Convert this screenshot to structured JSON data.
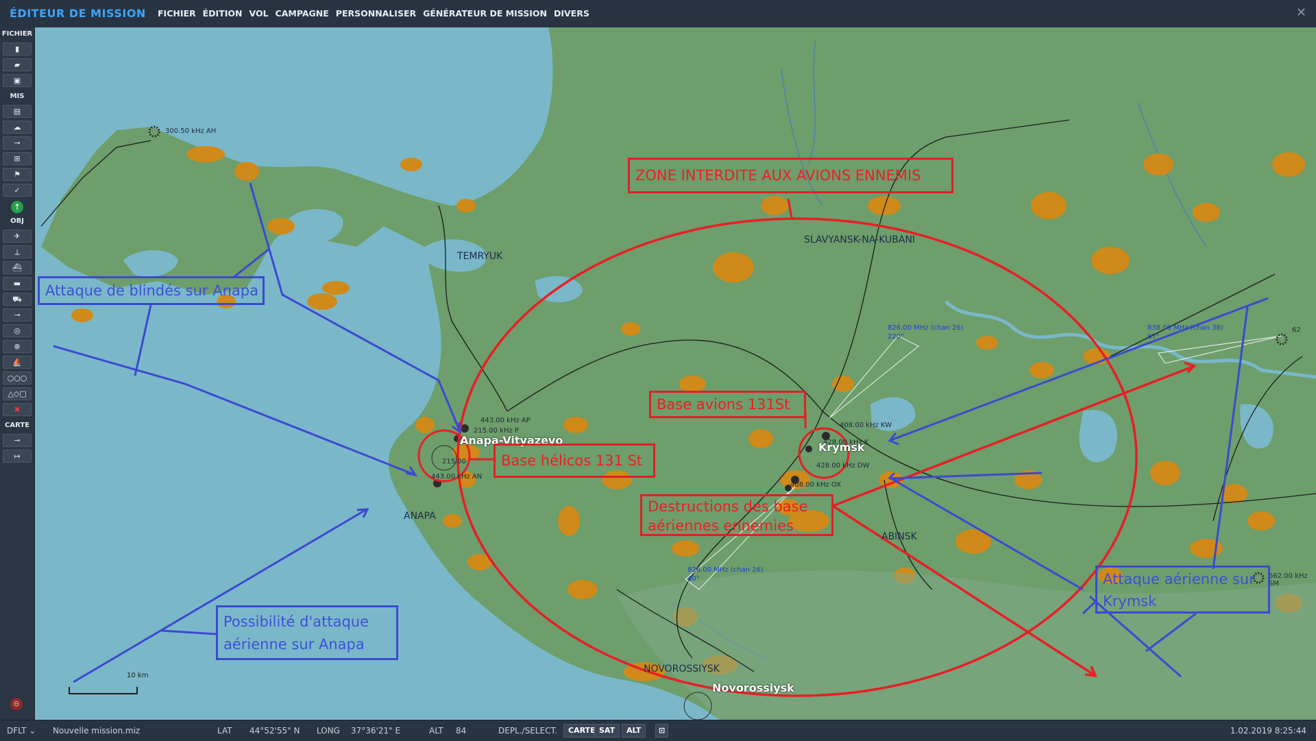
{
  "app": {
    "title": "ÉDITEUR DE MISSION",
    "close_icon": "close-icon"
  },
  "menu": [
    "FICHIER",
    "ÉDITION",
    "VOL",
    "CAMPAGNE",
    "PERSONNALISER",
    "GÉNÉRATEUR DE MISSION",
    "DIVERS"
  ],
  "toolbar": {
    "sections": {
      "file": "FICHIER",
      "mis": "MIS",
      "obj": "OBJ",
      "map": "CARTE"
    },
    "file_buttons": [
      "new-file-icon",
      "open-folder-icon",
      "save-icon"
    ],
    "mis_buttons": [
      "briefing-icon",
      "weather-icon",
      "route-icon",
      "trigger-zone-icon",
      "flag-icon",
      "check-icon"
    ],
    "obj_buttons": [
      "plane-icon",
      "helicopter-icon",
      "ship-icon",
      "vehicle-icon",
      "tank-icon",
      "airfield-icon",
      "target-icon",
      "static-icon",
      "boat-icon",
      "waypoint-chain-icon",
      "shapes-icon",
      "delete-icon"
    ],
    "map_buttons": [
      "map-key-icon",
      "ruler-icon"
    ]
  },
  "map_labels": {
    "temryuk": "TEMRYUK",
    "slavyansk": "SLAVYANSK-NA-KUBANI",
    "anapa_city": "ANAPA",
    "anapa_airfield": "Anapa-Vityazevo",
    "krymsk": "Krymsk",
    "abinsk": "ABINSK",
    "novorossiysk_region": "NOVOROSSIYSK",
    "novorossiysk_city": "Novorossiysk",
    "nav_anapa_ap": "443.00 kHz AP",
    "nav_anapa_freq_partial": "215.00 kHz P",
    "nav_anapa_215": "215.00",
    "nav_anapa_an": "443.00 kHz AN",
    "nav_ah": "300.50 kHz AH",
    "nav_kw": "408.00 kHz KW",
    "nav_krymsk_partial": "428.00 kHz K",
    "nav_dw": "428.00 kHz DW",
    "nav_ox": "408.00 kHz OX",
    "ils_krymsk_freq": "826.00 MHz (chan 26)",
    "ils_krymsk_hdg": "220°",
    "ils_south_freq": "826.00 MHz (chan 26)",
    "ils_south_hdg": "40°",
    "ils_east_freq": "838.00 MHz (chan 38)",
    "ils_east_hdg": "87°",
    "nav_east_partial": "62",
    "nav_sm": "662.00 kHz SM",
    "scale": "10 km"
  },
  "annotations": {
    "zone": "ZONE INTERDITE AUX AVIONS ENNEMIS",
    "attaque_blindes": "Attaque de blindés sur Anapa",
    "base_avions": "Base avions 131St",
    "base_helicos": "Base hélicos 131 St",
    "destructions_1": "Destructions des base",
    "destructions_2": "aériennes ennemies",
    "possibilite_1": "Possibilité d'attaque",
    "possibilite_2": "aérienne sur Anapa",
    "attaque_krymsk_1": "Attaque aérienne sur",
    "attaque_krymsk_2": "Krymsk"
  },
  "status": {
    "profile": "DFLT",
    "file": "Nouvelle mission.miz",
    "lat_label": "LAT",
    "lat": "44°52'55\" N",
    "long_label": "LONG",
    "long": "37°36'21\" E",
    "alt_label": "ALT",
    "alt": "84",
    "mode": "DEPL./SELECT.",
    "btn_map": "CARTE",
    "btn_sat": "SAT",
    "btn_alt": "ALT",
    "datetime": "1.02.2019 8:25:44"
  },
  "colors": {
    "sea": "#7ab8c9",
    "land": "#6d9e6b",
    "urban": "#cf8a1a",
    "annotation_red": "#e81e25",
    "annotation_blue": "#3c49d0",
    "accent": "#3ea4ff"
  }
}
